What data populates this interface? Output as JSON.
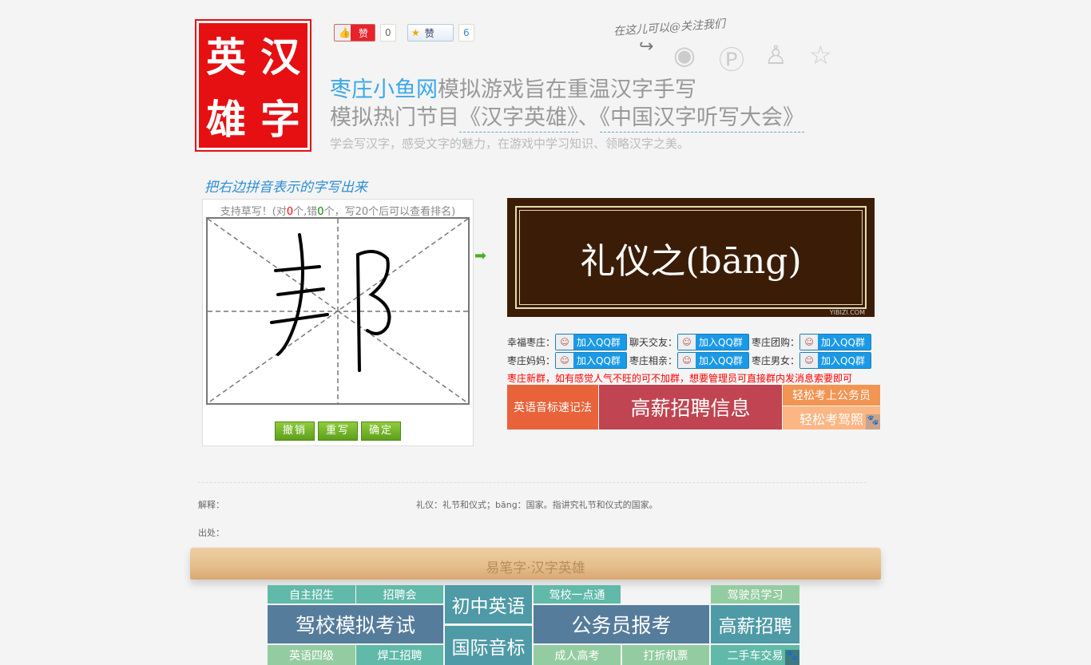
{
  "logo": {
    "chars": [
      "英",
      "汉",
      "雄",
      "字"
    ]
  },
  "social_buttons": {
    "like_label": "赞",
    "like_count": "0",
    "star_label": "赞",
    "star_count": "6"
  },
  "follow": {
    "text": "在这儿可以@关注我们",
    "icons": [
      "weibo-icon",
      "pinterest-icon",
      "qq-penguin-icon",
      "star-icon"
    ]
  },
  "header": {
    "brand": "枣庄小鱼网",
    "line1_rest": "模拟游戏旨在重温汉字手写",
    "line2_prefix": "模拟热门节目",
    "show1": "《汉字英雄》",
    "sep": "、",
    "show2": "《中国汉字听写大会》",
    "subtitle": "学会写汉字，感受文字的魅力，在游戏中学习知识、领略汉字之美。"
  },
  "game": {
    "instruction": "把右边拼音表示的字写出来",
    "caption_pre": "支持草写！(对",
    "right": "0",
    "caption_mid": "个,错",
    "wrong": "0",
    "caption_post": "个，写20个后可以查看排名)",
    "buttons": {
      "undo": "撤销",
      "rewrite": "重写",
      "confirm": "确定"
    },
    "question": "礼仪之(bāng)",
    "watermark": "YIBIZI.COM",
    "colors": {
      "right": "#ff0000",
      "wrong": "#008000"
    }
  },
  "qq_groups": {
    "button_label": "加入QQ群",
    "rows": [
      [
        "幸福枣庄：",
        "聊天交友：",
        "枣庄团购："
      ],
      [
        "枣庄妈妈：",
        "枣庄相亲：",
        "枣庄男女："
      ]
    ],
    "note": "枣庄新群，如有感觉人气不旺的可不加群，想要管理员可直接群内发消息索要即可"
  },
  "banners": {
    "a": "英语音标速记法",
    "b": "高薪招聘信息",
    "c": "轻松考上公务员",
    "d": "轻松考驾照"
  },
  "explain": {
    "label": "解释：",
    "text": "礼仪：礼节和仪式；bāng：国家。指讲究礼节和仪式的国家。",
    "source_label": "出处："
  },
  "shelf": {
    "text": "易笔字·汉字英雄"
  },
  "grid": {
    "t1": "自主招生",
    "t2": "招聘会",
    "t3": "初中英语",
    "t4": "驾校一点通",
    "t5": "驾驶员学习",
    "t6": "驾校模拟考试",
    "t7": "公务员报考",
    "t8": "高薪招聘",
    "t9": "国际音标",
    "t10": "英语四级",
    "t11": "焊工招聘",
    "t12": "成人高考",
    "t13": "打折机票",
    "t14": "二手车交易"
  }
}
